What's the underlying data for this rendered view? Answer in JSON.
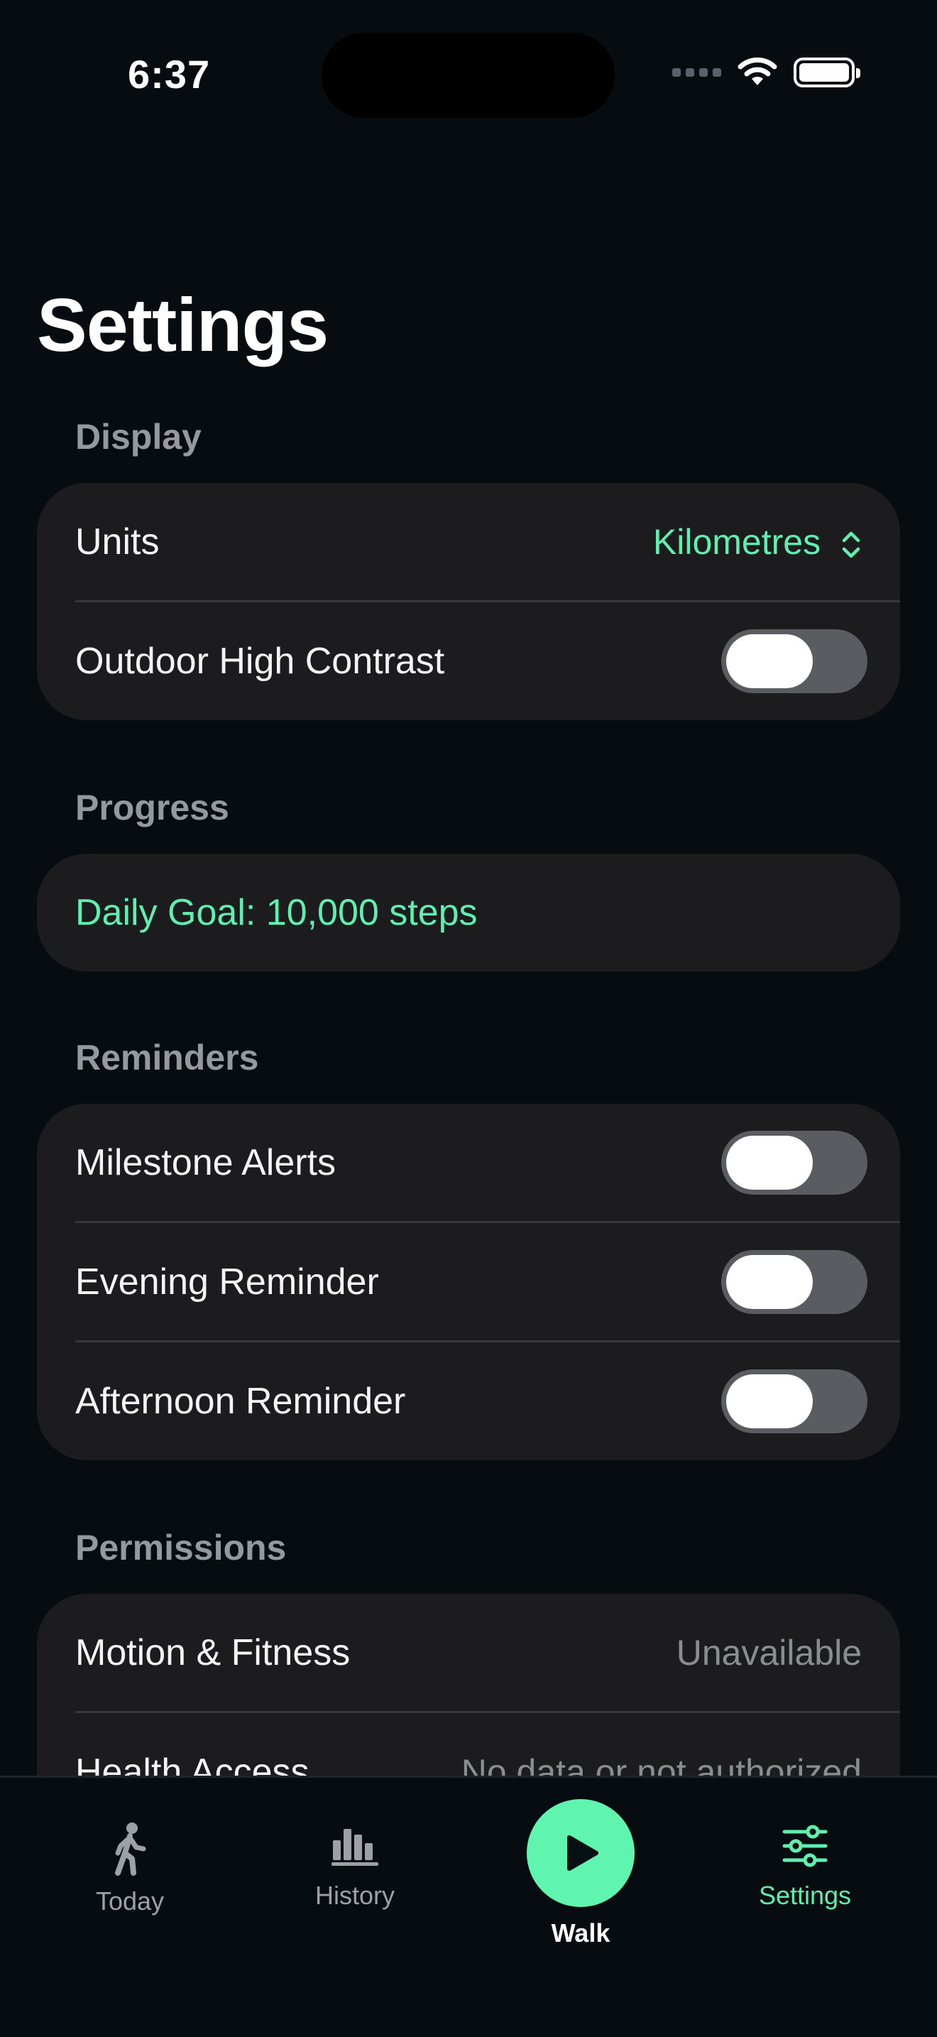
{
  "status_bar": {
    "time": "6:37"
  },
  "title": "Settings",
  "sections": {
    "display": {
      "header": "Display",
      "units_label": "Units",
      "units_value": "Kilometres",
      "high_contrast_label": "Outdoor High Contrast",
      "high_contrast_on": false
    },
    "progress": {
      "header": "Progress",
      "daily_goal": "Daily Goal: 10,000 steps"
    },
    "reminders": {
      "header": "Reminders",
      "milestone_label": "Milestone Alerts",
      "evening_label": "Evening Reminder",
      "afternoon_label": "Afternoon Reminder",
      "milestone_on": false,
      "evening_on": false,
      "afternoon_on": false
    },
    "permissions": {
      "header": "Permissions",
      "motion_label": "Motion & Fitness",
      "motion_value": "Unavailable",
      "health_label": "Health Access",
      "health_value": "No data or not authorized"
    }
  },
  "tabbar": {
    "today": "Today",
    "history": "History",
    "walk": "Walk",
    "settings": "Settings",
    "active": "settings"
  },
  "colors": {
    "accent": "#5fefae",
    "background": "#070c11",
    "card": "#1c1c1e"
  }
}
